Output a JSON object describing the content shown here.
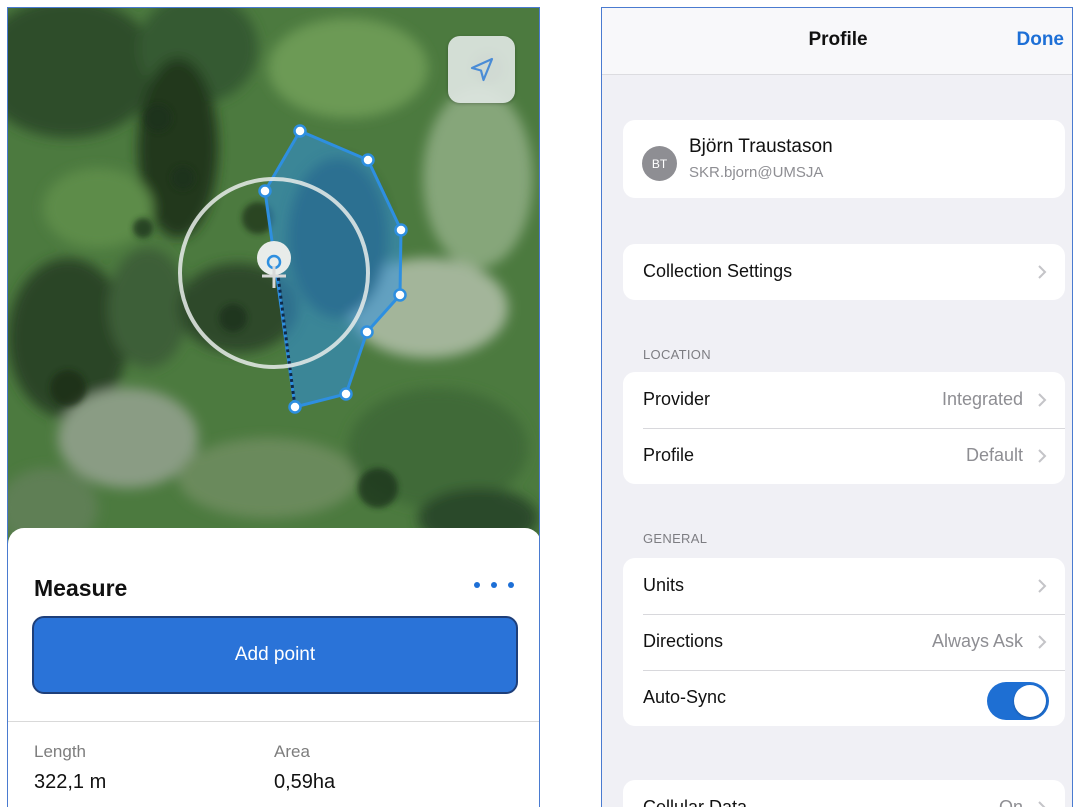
{
  "measure_screen": {
    "locate_icon": "navigation-arrow-icon",
    "sheet_title": "Measure",
    "more_icon": "ellipsis-icon",
    "add_point_label": "Add point",
    "length_label": "Length",
    "length_value": "322,1 m",
    "area_label": "Area",
    "area_value": "0,59ha",
    "accent_color": "#2a73d8",
    "polygon_color": "#2e8fe0"
  },
  "profile_screen": {
    "nav_title": "Profile",
    "done_label": "Done",
    "user": {
      "initials": "BT",
      "name": "Björn Traustason",
      "account": "SKR.bjorn@UMSJA"
    },
    "collection_settings_label": "Collection Settings",
    "location_section": {
      "header": "LOCATION",
      "provider_label": "Provider",
      "provider_value": "Integrated",
      "profile_label": "Profile",
      "profile_value": "Default"
    },
    "general_section": {
      "header": "GENERAL",
      "units_label": "Units",
      "directions_label": "Directions",
      "directions_value": "Always Ask",
      "auto_sync_label": "Auto-Sync",
      "auto_sync_on": true
    },
    "cellular_label": "Cellular Data",
    "cellular_value": "On",
    "accent_color": "#1d6fd6"
  }
}
